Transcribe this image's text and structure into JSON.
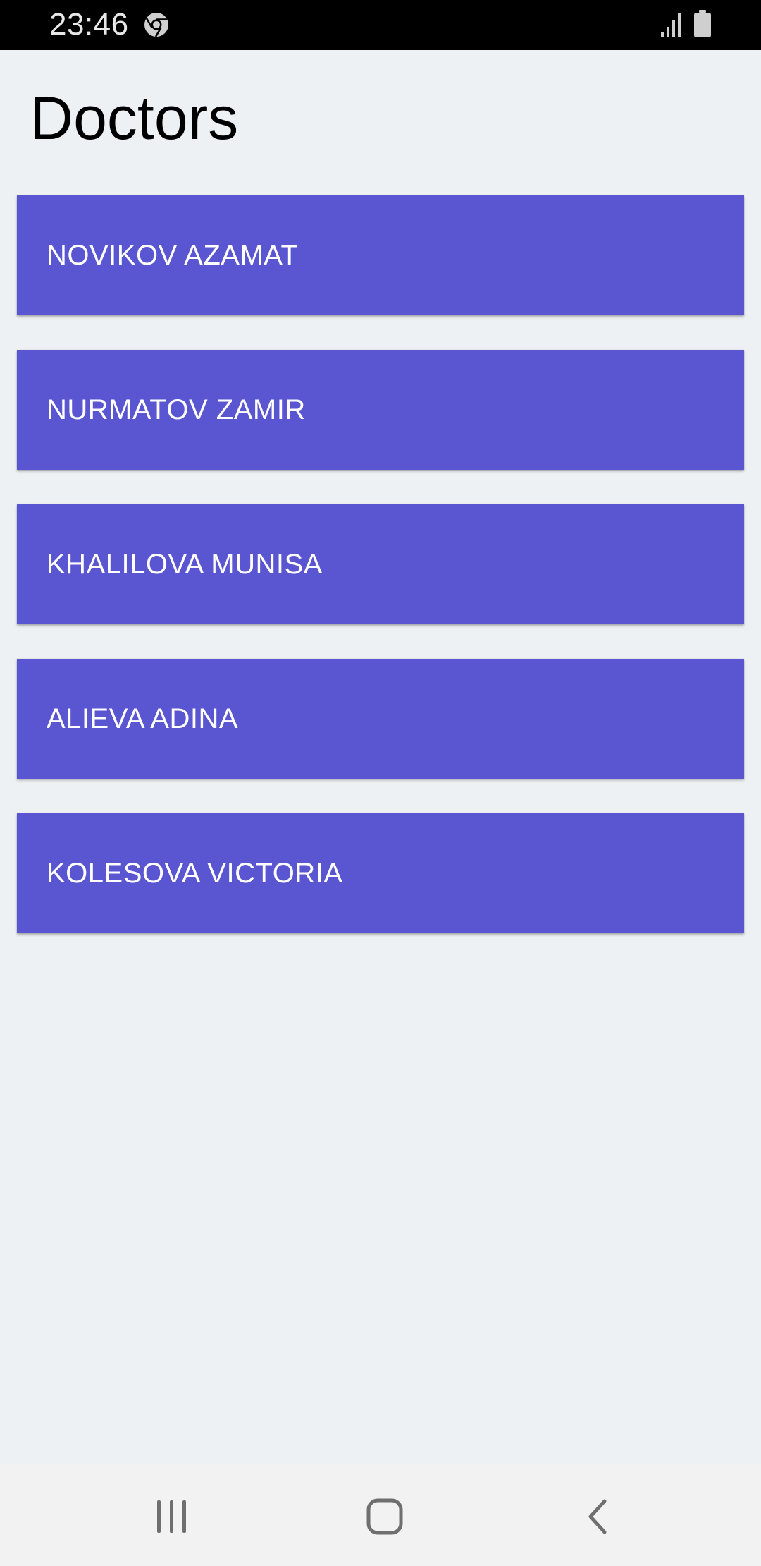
{
  "status_bar": {
    "time": "23:46",
    "icons": [
      "chrome-icon",
      "signal-icon",
      "battery-icon"
    ]
  },
  "page": {
    "title": "Doctors"
  },
  "doctors": [
    {
      "name": "NOVIKOV AZAMAT"
    },
    {
      "name": "NURMATOV ZAMIR"
    },
    {
      "name": "KHALILOVA MUNISA"
    },
    {
      "name": "ALIEVA ADINA"
    },
    {
      "name": "KOLESOVA VICTORIA"
    }
  ],
  "nav_bar": {
    "icons": [
      "recents-icon",
      "home-icon",
      "back-icon"
    ]
  },
  "colors": {
    "card_background": "#5a55d0",
    "page_background": "#eef1f3",
    "status_bar_background": "#000000",
    "nav_bar_background": "#f2f2f2"
  }
}
